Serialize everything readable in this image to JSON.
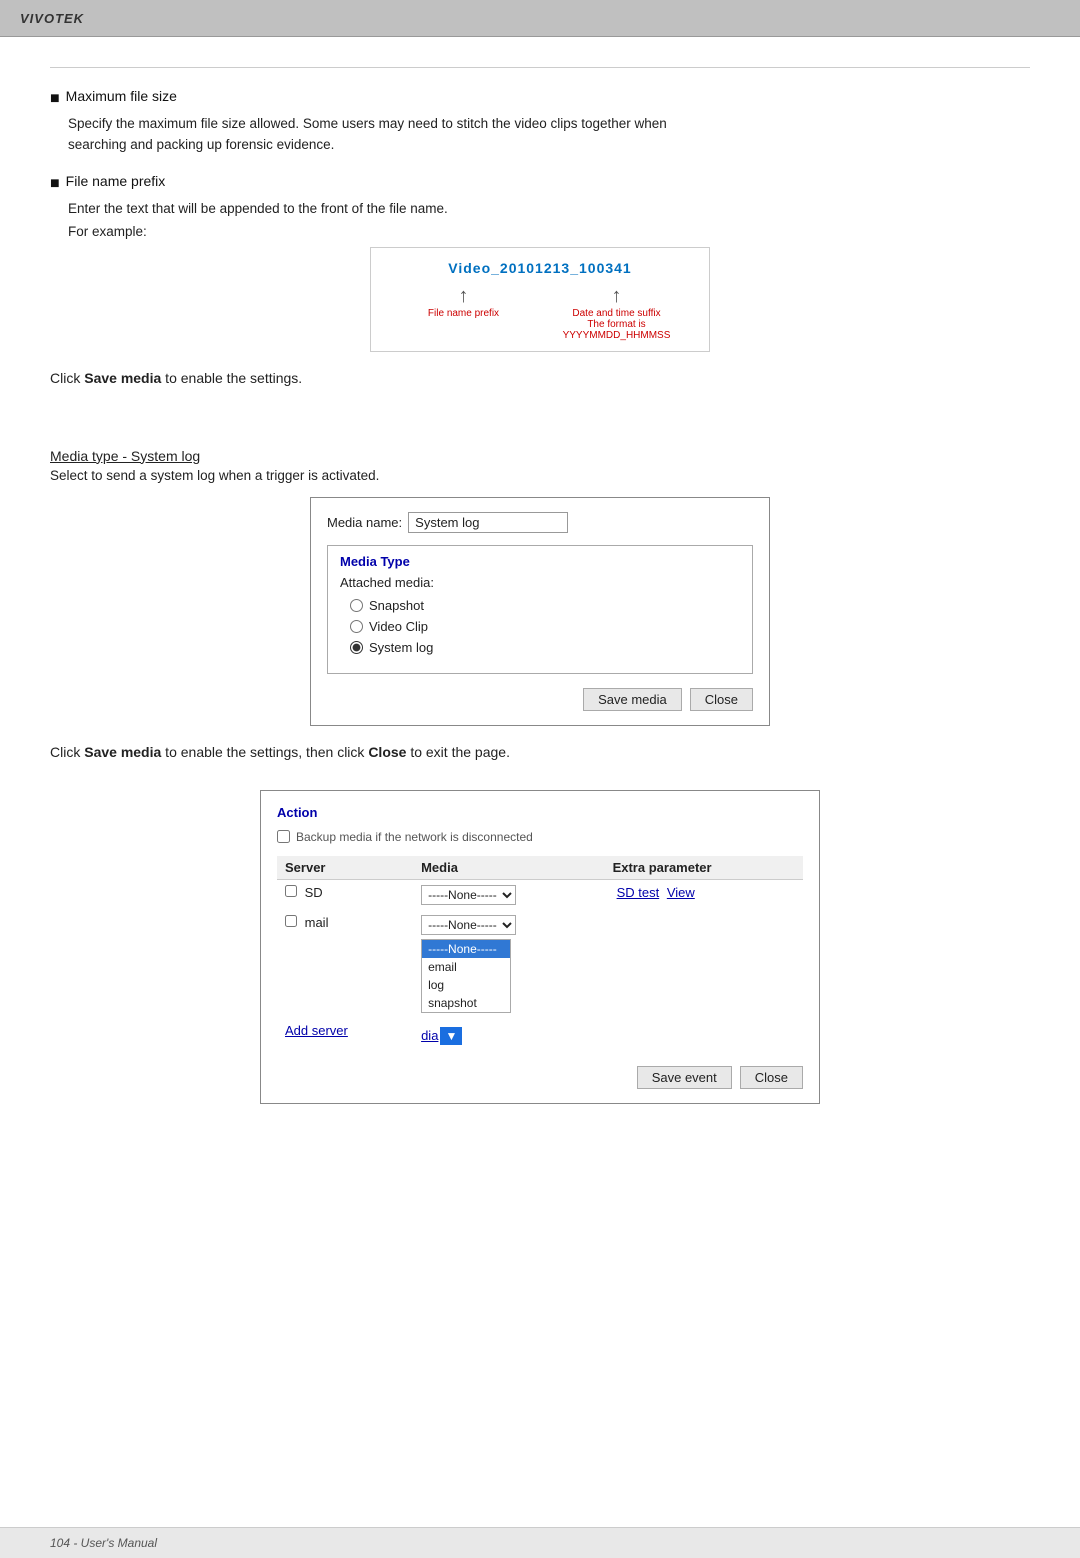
{
  "header": {
    "brand": "VIVOTEK"
  },
  "section_max_file_size": {
    "heading": "Maximum file size",
    "body1": "Specify the maximum file size allowed. Some users may need to stitch the video clips together when",
    "body2": "searching and packing up forensic evidence."
  },
  "section_file_prefix": {
    "heading": "File name prefix",
    "body1": "Enter the text that will be appended to the front of the file name.",
    "for_example": "For example:",
    "filename_example": "Video_20101213_100341",
    "label_left": "File name prefix",
    "label_right": "Date and time suffix\nThe format is YYYYMMDD_HHMMSS"
  },
  "click_save_media_1": {
    "text_before": "Click ",
    "bold": "Save media",
    "text_after": " to enable the settings."
  },
  "section_system_log": {
    "heading": "Media type - System log",
    "subtext": "Select to send a system log when a trigger is activated."
  },
  "dialog": {
    "media_name_label": "Media name:",
    "media_name_value": "System log",
    "media_type_legend": "Media Type",
    "attached_media_label": "Attached media:",
    "radio_snapshot": "Snapshot",
    "radio_video_clip": "Video Clip",
    "radio_system_log": "System log",
    "selected_radio": "system_log",
    "save_media_btn": "Save media",
    "close_btn": "Close"
  },
  "click_save_media_2": {
    "text_before": "Click ",
    "bold1": "Save media",
    "text_middle": " to enable the settings, then click ",
    "bold2": "Close",
    "text_after": " to exit the page."
  },
  "action_box": {
    "title": "Action",
    "backup_label": "Backup media if the network is disconnected",
    "col_server": "Server",
    "col_media": "Media",
    "col_extra": "Extra parameter",
    "rows": [
      {
        "server": "SD",
        "media_select": "-----None----- ▼",
        "extras": [
          "SD test",
          "View"
        ]
      },
      {
        "server": "mail",
        "media_select": "-----None----- ▼",
        "extras": []
      }
    ],
    "add_server_label": "Add server",
    "add_media_label": "dia",
    "dropdown_items": [
      "-----None-----",
      "email",
      "log",
      "snapshot"
    ],
    "dropdown_selected": "-----None-----",
    "save_event_btn": "Save event",
    "close_btn": "Close"
  },
  "footer": {
    "text": "104 - User's Manual"
  }
}
